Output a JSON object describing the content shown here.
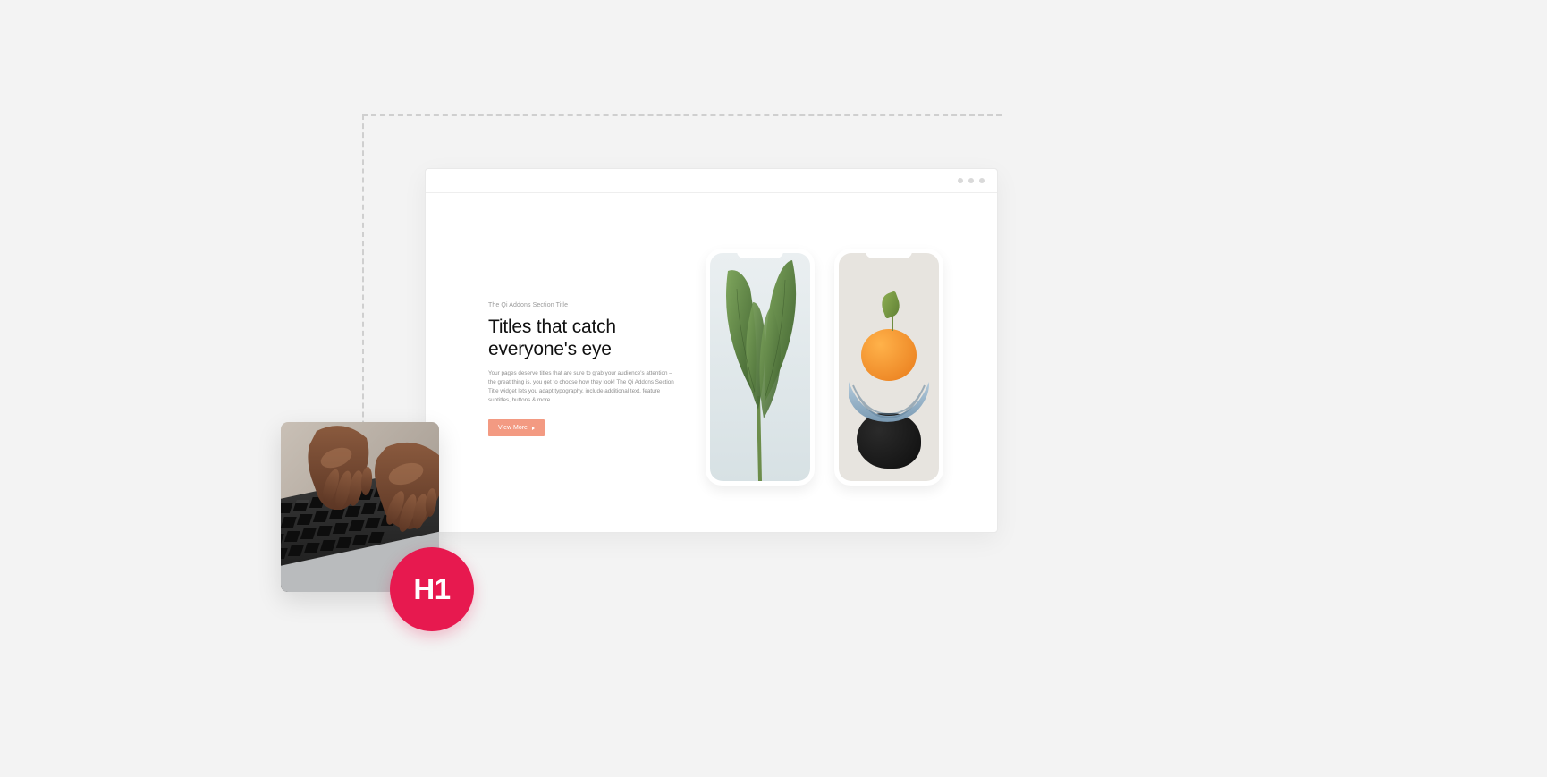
{
  "mockup": {
    "subtitle": "The Qi Addons Section Title",
    "headline": "Titles that catch everyone's eye",
    "body": "Your pages deserve titles that are sure to grab your audience's attention – the great thing is, you get to choose how they look! The Qi Addons Section Title widget lets you adapt typography, include additional text, feature subtitles, buttons & more.",
    "cta_label": "View More"
  },
  "badge": {
    "label": "H1"
  },
  "images": {
    "phone1_alt": "banana-leaf-plant",
    "phone2_alt": "orange-on-sculpture",
    "typing_alt": "hands-typing-on-laptop"
  }
}
